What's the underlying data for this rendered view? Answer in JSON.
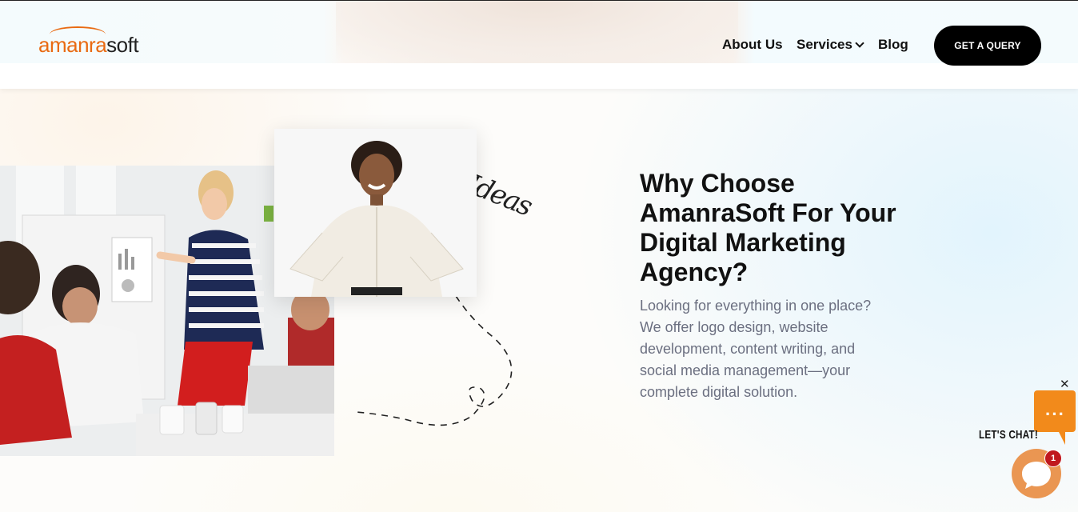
{
  "header": {
    "logo_part1": "amanra",
    "logo_part2": "soft",
    "nav": {
      "about": "About Us",
      "services": "Services",
      "blog": "Blog"
    },
    "cta_label": "GET A QUERY"
  },
  "hero": {
    "handwritten_word": "Ideas",
    "headline": "Why Choose AmanraSoft For Your Digital Marketing Agency?",
    "body": "Looking for everything in one place? We offer logo design, website development, content writing, and social media management—your complete digital solution."
  },
  "chat": {
    "label": "LET'S CHAT!",
    "dots": "···",
    "badge_count": "1",
    "close": "✕"
  },
  "colors": {
    "brand_orange": "#e96a12",
    "cta_black": "#000000",
    "chat_orange": "#f28a1b",
    "badge_red": "#c0181e",
    "body_grey": "#6b6f80"
  }
}
